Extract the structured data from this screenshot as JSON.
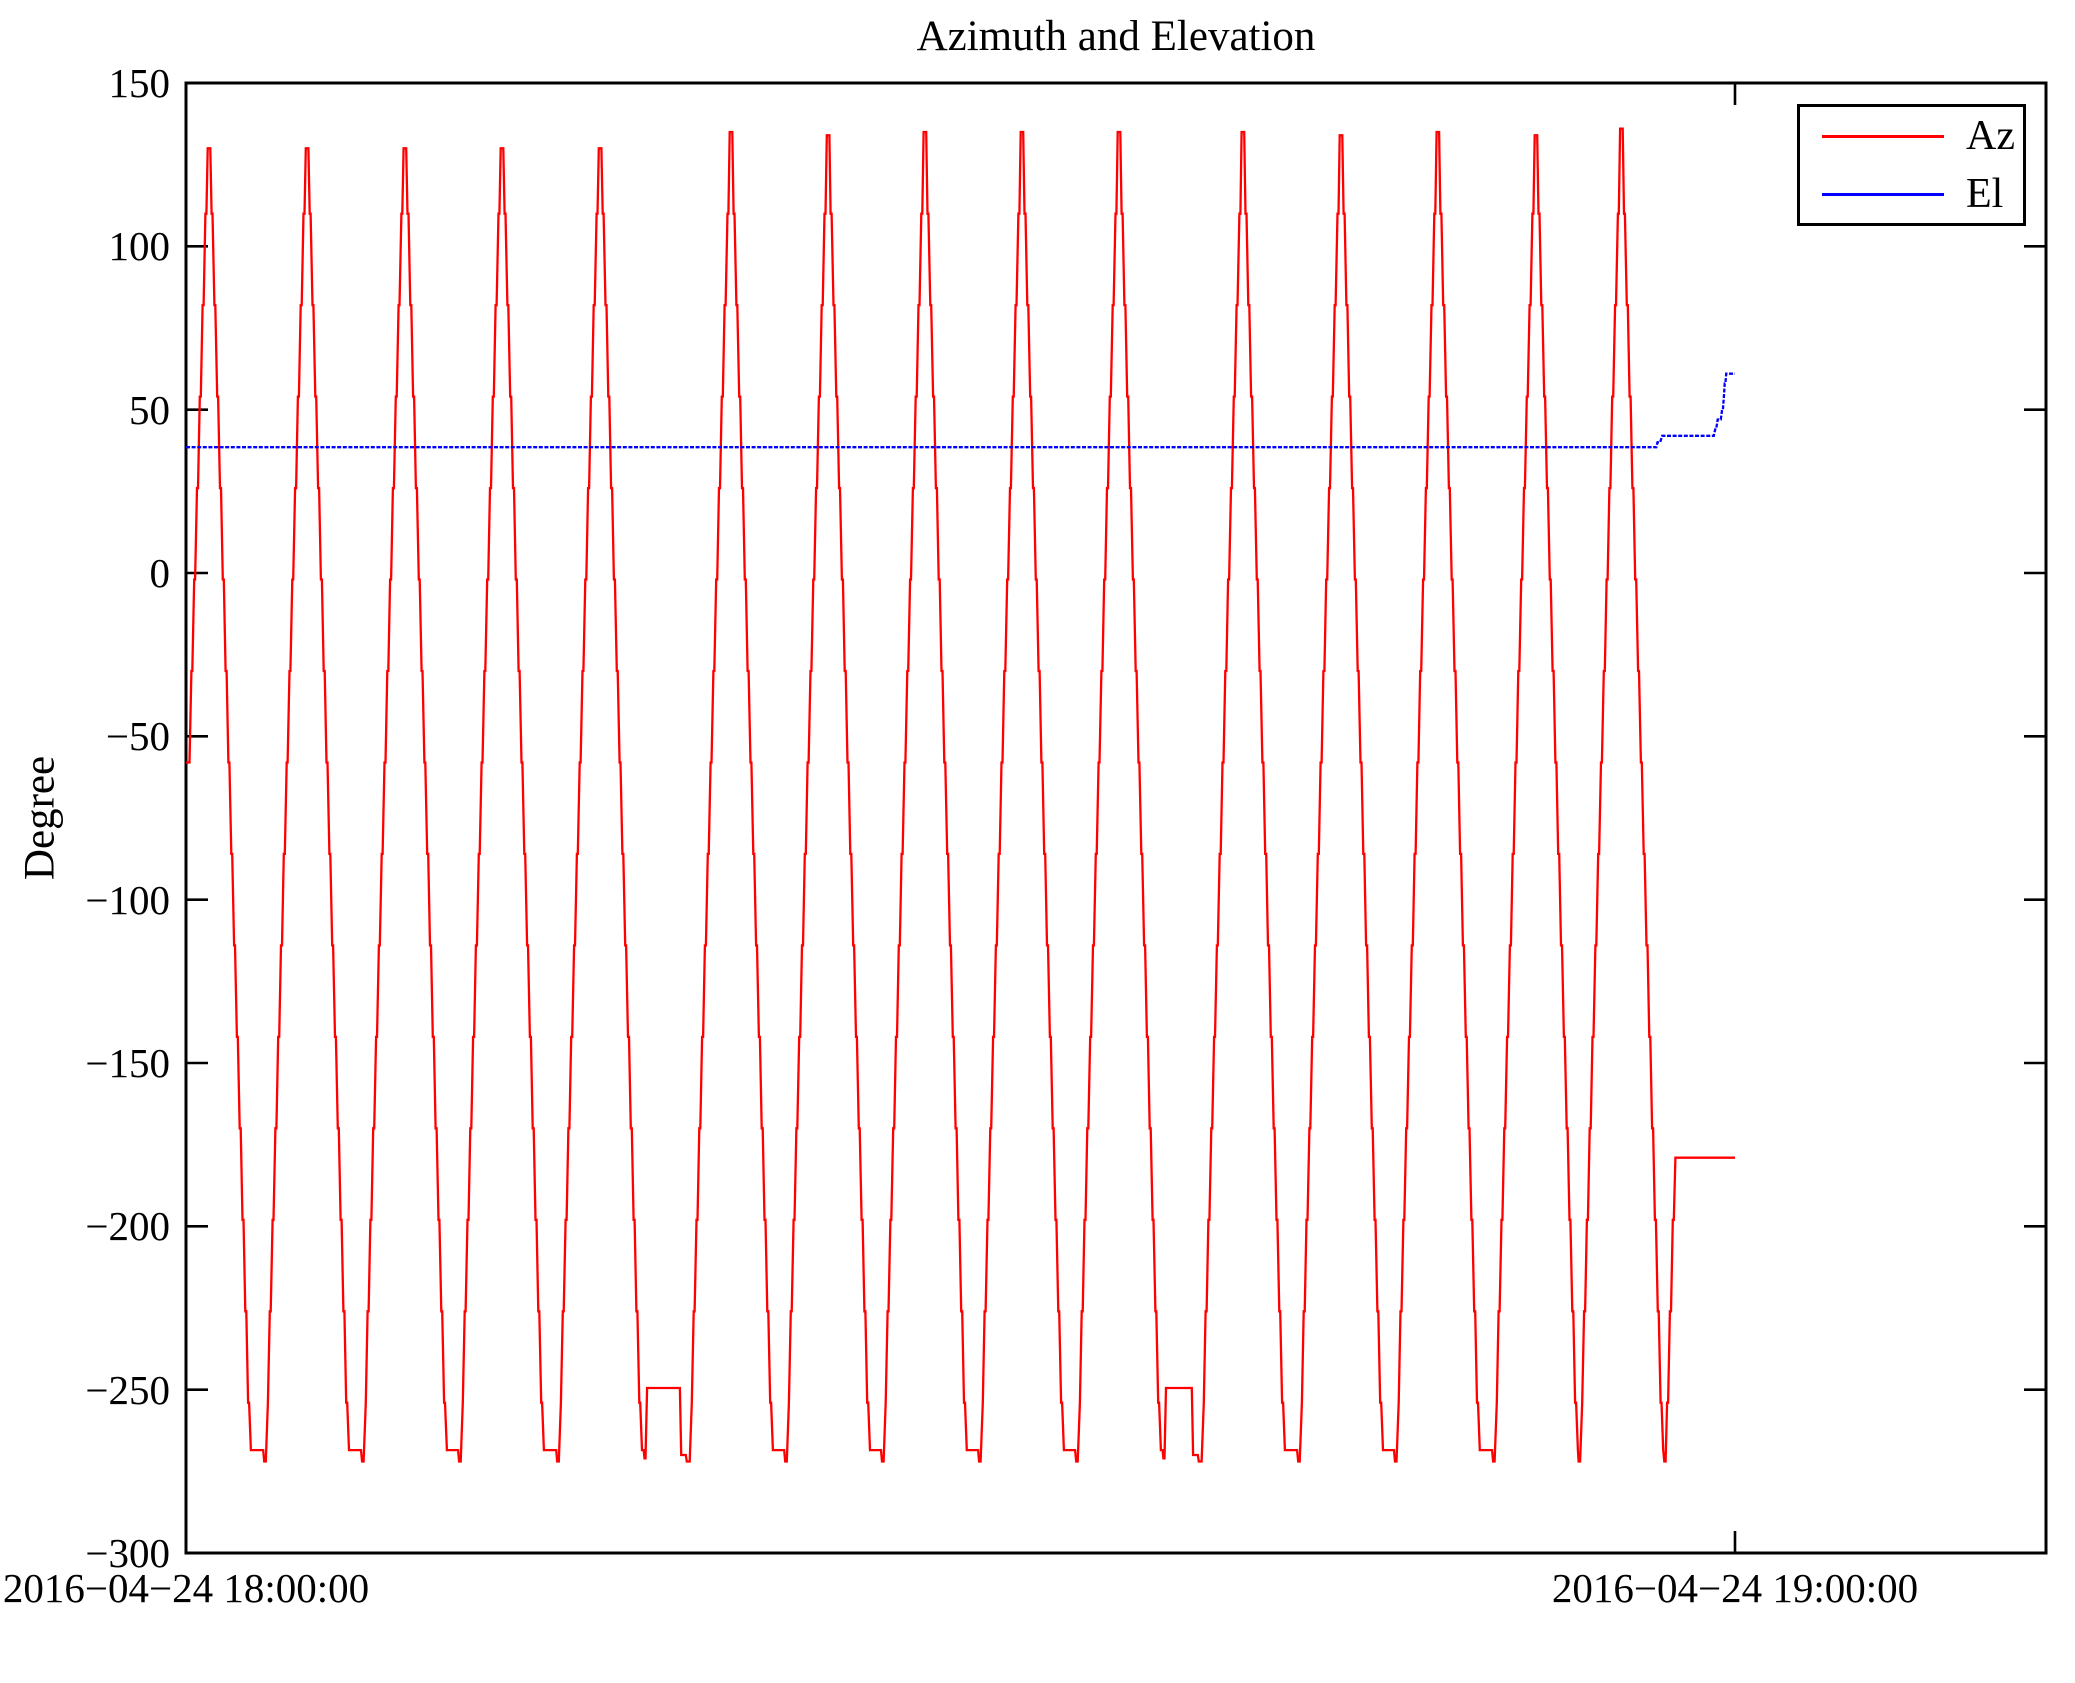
{
  "title": "Azimuth and Elevation",
  "y_axis_label": "Degree",
  "legend": {
    "items": [
      {
        "label": "Az",
        "color": "#ff0000"
      },
      {
        "label": "El",
        "color": "#0000ff"
      }
    ]
  },
  "chart_data": {
    "type": "line",
    "title": "Azimuth and Elevation",
    "ylabel": "Degree",
    "xlabel": "",
    "x_unit": "minutes after 2016-04-24 18:00:00",
    "xlim_minutes": [
      0,
      71.9
    ],
    "ylim": [
      -300,
      150
    ],
    "grid": false,
    "legend_position": "top-right",
    "yticks": [
      {
        "v": 150,
        "label": "150"
      },
      {
        "v": 100,
        "label": "100"
      },
      {
        "v": 50,
        "label": "50"
      },
      {
        "v": 0,
        "label": "0"
      },
      {
        "v": -50,
        "label": "−50"
      },
      {
        "v": -100,
        "label": "−100"
      },
      {
        "v": -150,
        "label": "−150"
      },
      {
        "v": -200,
        "label": "−200"
      },
      {
        "v": -250,
        "label": "−250"
      },
      {
        "v": -300,
        "label": "−300"
      }
    ],
    "xticks": [
      {
        "v": 0,
        "label": "2016−04−24 18:00:00"
      },
      {
        "v": 60,
        "label": "2016−04−24 19:00:00"
      }
    ],
    "series": [
      {
        "name": "Az",
        "color": "#ff0000",
        "style": "stepped-sawtooth",
        "start": [
          0,
          -58
        ],
        "peaks": [
          [
            0.89,
            130
          ],
          [
            4.69,
            130
          ],
          [
            8.48,
            130
          ],
          [
            12.24,
            130
          ],
          [
            16.04,
            130
          ],
          [
            21.11,
            135
          ],
          [
            24.87,
            134
          ],
          [
            28.62,
            135
          ],
          [
            32.38,
            135
          ],
          [
            36.14,
            135
          ],
          [
            40.94,
            135
          ],
          [
            44.74,
            134
          ],
          [
            48.49,
            135
          ],
          [
            52.29,
            134
          ],
          [
            55.6,
            136
          ]
        ],
        "anomaly_after_peak_index": [
          4,
          9
        ],
        "shape": {
          "ladder_top": 110,
          "ladder_bottom": -254,
          "step_deg": 28,
          "rise_min": 0.072,
          "pause_min": 0.037,
          "cap_rise_min": 0.05,
          "cap_half_flat_min": 0.05,
          "trough_deg": -268.5,
          "dip_deg": -272,
          "anomaly_plateau_deg": -249.5,
          "anomaly_shoulder_deg": -270
        },
        "tail": [
          [
            57.22,
            -268.5
          ],
          [
            57.26,
            -272
          ],
          [
            57.31,
            -272
          ],
          [
            57.37,
            -254
          ],
          [
            57.41,
            -254
          ],
          [
            57.48,
            -226
          ],
          [
            57.52,
            -226
          ],
          [
            57.59,
            -198
          ],
          [
            57.63,
            -198
          ],
          [
            57.69,
            -179
          ],
          [
            60.0,
            -179
          ]
        ]
      },
      {
        "name": "El",
        "color": "#0000ff",
        "points": [
          [
            0,
            38.5
          ],
          [
            56.95,
            38.5
          ],
          [
            57.0,
            40
          ],
          [
            57.1,
            40
          ],
          [
            57.18,
            42
          ],
          [
            59.18,
            42
          ],
          [
            59.25,
            44.5
          ],
          [
            59.28,
            44.5
          ],
          [
            59.33,
            47
          ],
          [
            59.45,
            47
          ],
          [
            59.5,
            50
          ],
          [
            59.53,
            50
          ],
          [
            59.57,
            54
          ],
          [
            59.6,
            58
          ],
          [
            59.63,
            58
          ],
          [
            59.66,
            61
          ],
          [
            60.0,
            61
          ]
        ]
      }
    ]
  }
}
